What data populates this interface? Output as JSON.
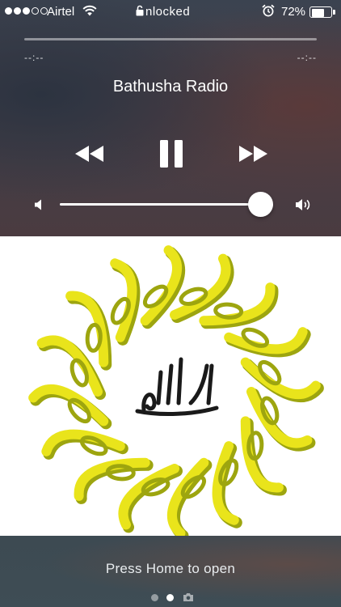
{
  "status_bar": {
    "signal_dots": 5,
    "signal_dots_filled": 3,
    "carrier": "Airtel",
    "lock_text": "nlocked",
    "battery_percent": "72%",
    "battery_level": 0.72,
    "icons": [
      "wifi-icon",
      "lock-icon",
      "alarm-clock-icon",
      "battery-icon"
    ]
  },
  "player": {
    "elapsed": "--:--",
    "remaining": "--:--",
    "progress": 0,
    "title": "Bathusha Radio",
    "controls": [
      "rewind-icon",
      "pause-icon",
      "fast-forward-icon"
    ],
    "volume_level": 0.95,
    "volume_icons": [
      "speaker-low-icon",
      "speaker-high-icon"
    ]
  },
  "artwork": {
    "description_icon": "calligraphy-emblem-icon",
    "colors": {
      "ring": "#e9e41b",
      "ring_shadow": "#9da50f",
      "ink": "#1a1a1a"
    }
  },
  "lock_screen": {
    "hint": "Press Home to open",
    "pages": 2,
    "active_page": 1,
    "camera_icon": "camera-icon"
  }
}
